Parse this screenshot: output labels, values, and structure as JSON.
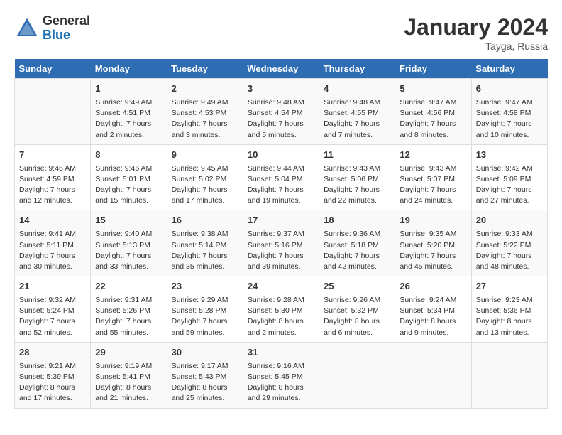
{
  "header": {
    "logo_general": "General",
    "logo_blue": "Blue",
    "month_year": "January 2024",
    "location": "Tayga, Russia"
  },
  "weekdays": [
    "Sunday",
    "Monday",
    "Tuesday",
    "Wednesday",
    "Thursday",
    "Friday",
    "Saturday"
  ],
  "weeks": [
    [
      {
        "day": "",
        "details": []
      },
      {
        "day": "1",
        "details": [
          "Sunrise: 9:49 AM",
          "Sunset: 4:51 PM",
          "Daylight: 7 hours",
          "and 2 minutes."
        ]
      },
      {
        "day": "2",
        "details": [
          "Sunrise: 9:49 AM",
          "Sunset: 4:53 PM",
          "Daylight: 7 hours",
          "and 3 minutes."
        ]
      },
      {
        "day": "3",
        "details": [
          "Sunrise: 9:48 AM",
          "Sunset: 4:54 PM",
          "Daylight: 7 hours",
          "and 5 minutes."
        ]
      },
      {
        "day": "4",
        "details": [
          "Sunrise: 9:48 AM",
          "Sunset: 4:55 PM",
          "Daylight: 7 hours",
          "and 7 minutes."
        ]
      },
      {
        "day": "5",
        "details": [
          "Sunrise: 9:47 AM",
          "Sunset: 4:56 PM",
          "Daylight: 7 hours",
          "and 8 minutes."
        ]
      },
      {
        "day": "6",
        "details": [
          "Sunrise: 9:47 AM",
          "Sunset: 4:58 PM",
          "Daylight: 7 hours",
          "and 10 minutes."
        ]
      }
    ],
    [
      {
        "day": "7",
        "details": [
          "Sunrise: 9:46 AM",
          "Sunset: 4:59 PM",
          "Daylight: 7 hours",
          "and 12 minutes."
        ]
      },
      {
        "day": "8",
        "details": [
          "Sunrise: 9:46 AM",
          "Sunset: 5:01 PM",
          "Daylight: 7 hours",
          "and 15 minutes."
        ]
      },
      {
        "day": "9",
        "details": [
          "Sunrise: 9:45 AM",
          "Sunset: 5:02 PM",
          "Daylight: 7 hours",
          "and 17 minutes."
        ]
      },
      {
        "day": "10",
        "details": [
          "Sunrise: 9:44 AM",
          "Sunset: 5:04 PM",
          "Daylight: 7 hours",
          "and 19 minutes."
        ]
      },
      {
        "day": "11",
        "details": [
          "Sunrise: 9:43 AM",
          "Sunset: 5:06 PM",
          "Daylight: 7 hours",
          "and 22 minutes."
        ]
      },
      {
        "day": "12",
        "details": [
          "Sunrise: 9:43 AM",
          "Sunset: 5:07 PM",
          "Daylight: 7 hours",
          "and 24 minutes."
        ]
      },
      {
        "day": "13",
        "details": [
          "Sunrise: 9:42 AM",
          "Sunset: 5:09 PM",
          "Daylight: 7 hours",
          "and 27 minutes."
        ]
      }
    ],
    [
      {
        "day": "14",
        "details": [
          "Sunrise: 9:41 AM",
          "Sunset: 5:11 PM",
          "Daylight: 7 hours",
          "and 30 minutes."
        ]
      },
      {
        "day": "15",
        "details": [
          "Sunrise: 9:40 AM",
          "Sunset: 5:13 PM",
          "Daylight: 7 hours",
          "and 33 minutes."
        ]
      },
      {
        "day": "16",
        "details": [
          "Sunrise: 9:38 AM",
          "Sunset: 5:14 PM",
          "Daylight: 7 hours",
          "and 35 minutes."
        ]
      },
      {
        "day": "17",
        "details": [
          "Sunrise: 9:37 AM",
          "Sunset: 5:16 PM",
          "Daylight: 7 hours",
          "and 39 minutes."
        ]
      },
      {
        "day": "18",
        "details": [
          "Sunrise: 9:36 AM",
          "Sunset: 5:18 PM",
          "Daylight: 7 hours",
          "and 42 minutes."
        ]
      },
      {
        "day": "19",
        "details": [
          "Sunrise: 9:35 AM",
          "Sunset: 5:20 PM",
          "Daylight: 7 hours",
          "and 45 minutes."
        ]
      },
      {
        "day": "20",
        "details": [
          "Sunrise: 9:33 AM",
          "Sunset: 5:22 PM",
          "Daylight: 7 hours",
          "and 48 minutes."
        ]
      }
    ],
    [
      {
        "day": "21",
        "details": [
          "Sunrise: 9:32 AM",
          "Sunset: 5:24 PM",
          "Daylight: 7 hours",
          "and 52 minutes."
        ]
      },
      {
        "day": "22",
        "details": [
          "Sunrise: 9:31 AM",
          "Sunset: 5:26 PM",
          "Daylight: 7 hours",
          "and 55 minutes."
        ]
      },
      {
        "day": "23",
        "details": [
          "Sunrise: 9:29 AM",
          "Sunset: 5:28 PM",
          "Daylight: 7 hours",
          "and 59 minutes."
        ]
      },
      {
        "day": "24",
        "details": [
          "Sunrise: 9:28 AM",
          "Sunset: 5:30 PM",
          "Daylight: 8 hours",
          "and 2 minutes."
        ]
      },
      {
        "day": "25",
        "details": [
          "Sunrise: 9:26 AM",
          "Sunset: 5:32 PM",
          "Daylight: 8 hours",
          "and 6 minutes."
        ]
      },
      {
        "day": "26",
        "details": [
          "Sunrise: 9:24 AM",
          "Sunset: 5:34 PM",
          "Daylight: 8 hours",
          "and 9 minutes."
        ]
      },
      {
        "day": "27",
        "details": [
          "Sunrise: 9:23 AM",
          "Sunset: 5:36 PM",
          "Daylight: 8 hours",
          "and 13 minutes."
        ]
      }
    ],
    [
      {
        "day": "28",
        "details": [
          "Sunrise: 9:21 AM",
          "Sunset: 5:39 PM",
          "Daylight: 8 hours",
          "and 17 minutes."
        ]
      },
      {
        "day": "29",
        "details": [
          "Sunrise: 9:19 AM",
          "Sunset: 5:41 PM",
          "Daylight: 8 hours",
          "and 21 minutes."
        ]
      },
      {
        "day": "30",
        "details": [
          "Sunrise: 9:17 AM",
          "Sunset: 5:43 PM",
          "Daylight: 8 hours",
          "and 25 minutes."
        ]
      },
      {
        "day": "31",
        "details": [
          "Sunrise: 9:16 AM",
          "Sunset: 5:45 PM",
          "Daylight: 8 hours",
          "and 29 minutes."
        ]
      },
      {
        "day": "",
        "details": []
      },
      {
        "day": "",
        "details": []
      },
      {
        "day": "",
        "details": []
      }
    ]
  ]
}
